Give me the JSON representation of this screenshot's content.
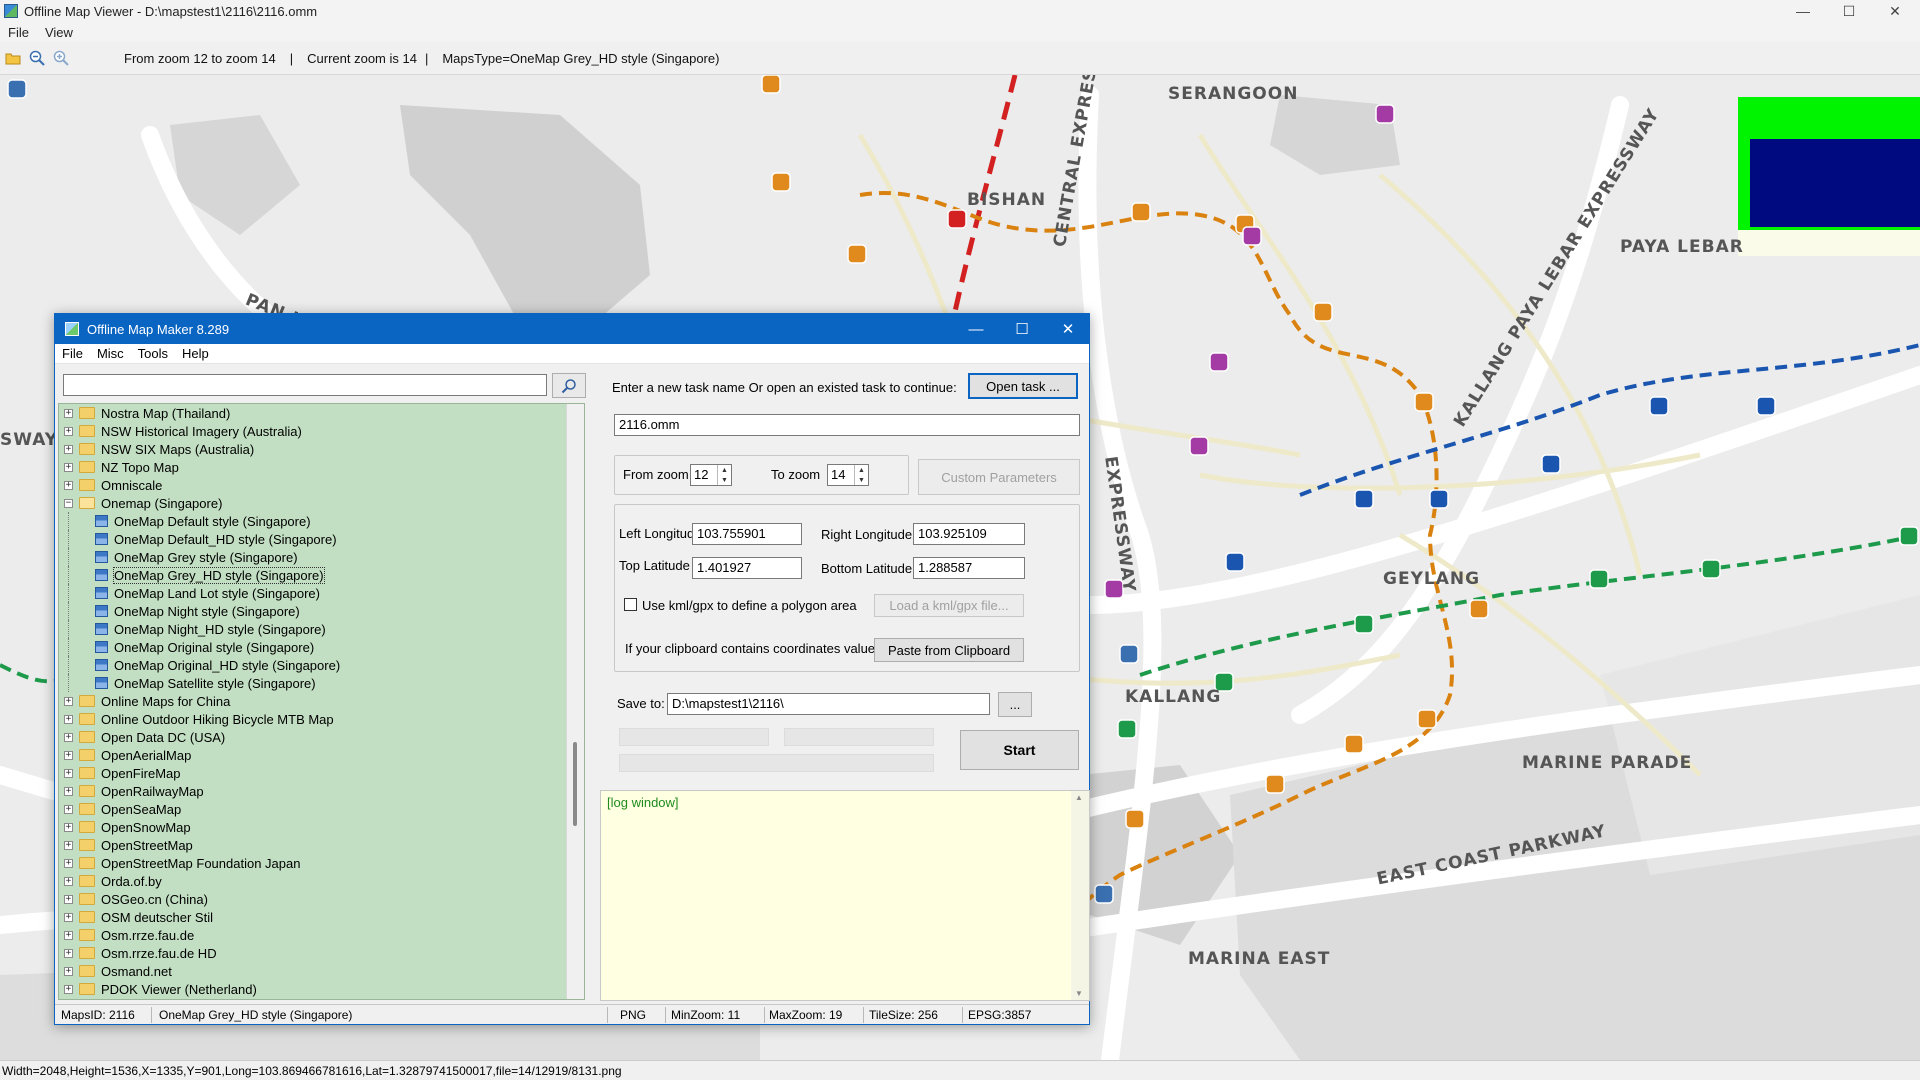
{
  "window": {
    "title": "Offline Map Viewer - D:\\mapstest1\\2116\\2116.omm",
    "controls": {
      "minimize": "—",
      "maximize": "☐",
      "close": "✕"
    }
  },
  "menu": {
    "file": "File",
    "view": "View"
  },
  "toolbar": {
    "zoom_range": "From zoom 12 to zoom 14",
    "separator": "|",
    "current_zoom": "Current zoom is 14",
    "maps_type": "MapsType=OneMap Grey_HD style (Singapore)"
  },
  "map": {
    "labels": {
      "serangoon": "SERANGOON",
      "bishan": "BISHAN",
      "central_expressway": "CENTRAL EXPRESSWAY",
      "pan_island": "PAN ISLAND EXPRESSWAY",
      "kpe": "KALLANG PAYA LEBAR EXPRESSWAY",
      "paya_lebar": "PAYA LEBAR",
      "geylang": "GEYLANG",
      "kallang": "KALLANG",
      "marine_parade": "MARINE PARADE",
      "ecp": "EAST COAST PARKWAY",
      "marina_east": "MARINA EAST",
      "sway": "SWAY",
      "expressway_left": "EXPRESSWAY"
    }
  },
  "statusbar": {
    "text": "Width=2048,Height=1536,X=1335,Y=901,Long=103.869466781616,Lat=1.32879741500017,file=14/12919/8131.png"
  },
  "dialog": {
    "title": "Offline Map Maker 8.289",
    "controls": {
      "minimize": "—",
      "maximize": "☐",
      "close": "✕"
    },
    "menu": {
      "file": "File",
      "misc": "Misc",
      "tools": "Tools",
      "help": "Help"
    },
    "search": {
      "value": "",
      "placeholder": ""
    },
    "tree": [
      {
        "label": "Nostra Map (Thailand)",
        "kind": "folder"
      },
      {
        "label": "NSW Historical Imagery (Australia)",
        "kind": "folder"
      },
      {
        "label": "NSW SIX Maps (Australia)",
        "kind": "folder"
      },
      {
        "label": "NZ Topo Map",
        "kind": "folder"
      },
      {
        "label": "Omniscale",
        "kind": "folder"
      },
      {
        "label": "Onemap (Singapore)",
        "kind": "folder-open"
      },
      {
        "label": "OneMap Default style (Singapore)",
        "kind": "map"
      },
      {
        "label": "OneMap Default_HD style (Singapore)",
        "kind": "map"
      },
      {
        "label": "OneMap Grey style (Singapore)",
        "kind": "map"
      },
      {
        "label": "OneMap Grey_HD style (Singapore)",
        "kind": "map",
        "selected": true
      },
      {
        "label": "OneMap Land Lot style (Singapore)",
        "kind": "map"
      },
      {
        "label": "OneMap Night style (Singapore)",
        "kind": "map"
      },
      {
        "label": "OneMap Night_HD style (Singapore)",
        "kind": "map"
      },
      {
        "label": "OneMap Original style (Singapore)",
        "kind": "map"
      },
      {
        "label": "OneMap Original_HD style (Singapore)",
        "kind": "map"
      },
      {
        "label": "OneMap Satellite style (Singapore)",
        "kind": "map"
      },
      {
        "label": "Online Maps for China",
        "kind": "folder"
      },
      {
        "label": "Online Outdoor Hiking Bicycle MTB Map",
        "kind": "folder"
      },
      {
        "label": "Open Data DC (USA)",
        "kind": "folder"
      },
      {
        "label": "OpenAerialMap",
        "kind": "folder"
      },
      {
        "label": "OpenFireMap",
        "kind": "folder"
      },
      {
        "label": "OpenRailwayMap",
        "kind": "folder"
      },
      {
        "label": "OpenSeaMap",
        "kind": "folder"
      },
      {
        "label": "OpenSnowMap",
        "kind": "folder"
      },
      {
        "label": "OpenStreetMap",
        "kind": "folder"
      },
      {
        "label": "OpenStreetMap Foundation Japan",
        "kind": "folder"
      },
      {
        "label": "Orda.of.by",
        "kind": "folder"
      },
      {
        "label": "OSGeo.cn (China)",
        "kind": "folder"
      },
      {
        "label": "OSM deutscher Stil",
        "kind": "folder"
      },
      {
        "label": "Osm.rrze.fau.de",
        "kind": "folder"
      },
      {
        "label": "Osm.rrze.fau.de HD",
        "kind": "folder"
      },
      {
        "label": "Osmand.net",
        "kind": "folder"
      },
      {
        "label": "PDOK Viewer (Netherland)",
        "kind": "folder"
      }
    ],
    "task": {
      "prompt": "Enter a new task name Or open an existed task to continue:",
      "open_button": "Open task ...",
      "name_value": "2116.omm"
    },
    "zoom": {
      "from_label": "From zoom",
      "from_value": "12",
      "to_label": "To zoom",
      "to_value": "14",
      "custom_button": "Custom Parameters"
    },
    "coords": {
      "left_lon_label": "Left Longitude",
      "left_lon_value": "103.755901",
      "right_lon_label": "Right Longitude",
      "right_lon_value": "103.925109",
      "top_lat_label": "Top Latitude",
      "top_lat_value": "1.401927",
      "bottom_lat_label": "Bottom Latitude",
      "bottom_lat_value": "1.288587",
      "kml_label": "Use kml/gpx to define a polygon area",
      "kml_button": "Load a kml/gpx file...",
      "clipboard_label": "If your clipboard contains coordinates values:",
      "clipboard_button": "Paste from Clipboard"
    },
    "save": {
      "label": "Save to:",
      "value": "D:\\mapstest1\\2116\\",
      "browse_button": "...",
      "start_button": "Start"
    },
    "log": {
      "text": "[log window]"
    },
    "status": {
      "maps_id": "MapsID: 2116",
      "maps_name": "OneMap Grey_HD style (Singapore)",
      "format": "PNG",
      "min_zoom": "MinZoom: 11",
      "max_zoom": "MaxZoom: 19",
      "tile_size": "TileSize: 256",
      "epsg": "EPSG:3857"
    }
  },
  "colors": {
    "dialog_accent": "#0a64c2",
    "tree_background": "#c3dfc3",
    "log_background": "#ffffe1",
    "circle_line": "#d9820f",
    "downtown_line": "#1a56b0",
    "east_west_line": "#1e9a4b",
    "north_south_line": "#d32020"
  }
}
